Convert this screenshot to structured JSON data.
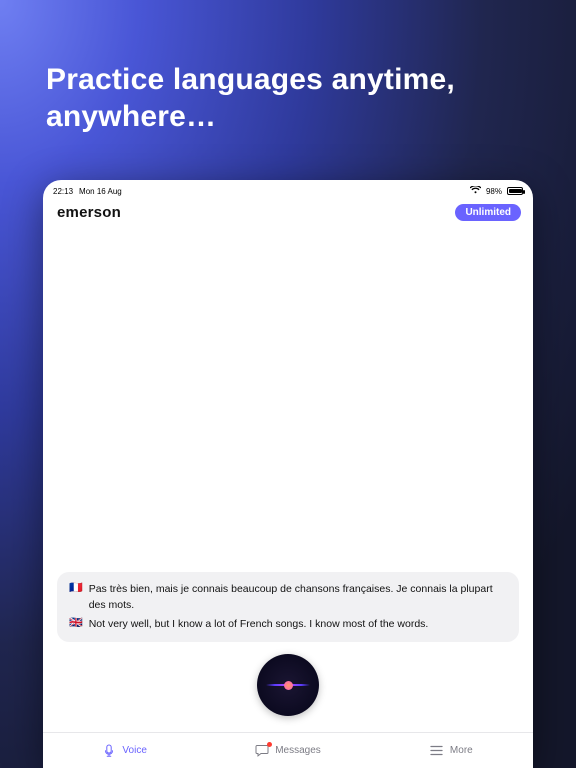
{
  "marketing": {
    "headline": "Practice languages anytime, anywhere…"
  },
  "statusbar": {
    "time": "22:13",
    "date": "Mon 16 Aug",
    "battery_text": "98%"
  },
  "header": {
    "app_name": "emerson",
    "badge": "Unlimited"
  },
  "chat": {
    "bubble": {
      "fr_flag": "🇫🇷",
      "fr_text": "Pas très bien, mais je connais beaucoup de chansons françaises. Je connais la plupart des mots.",
      "en_flag": "🇬🇧",
      "en_text": "Not very well, but I know a lot of French songs. I know most of the words."
    }
  },
  "tabs": {
    "voice": "Voice",
    "messages": "Messages",
    "more": "More"
  }
}
